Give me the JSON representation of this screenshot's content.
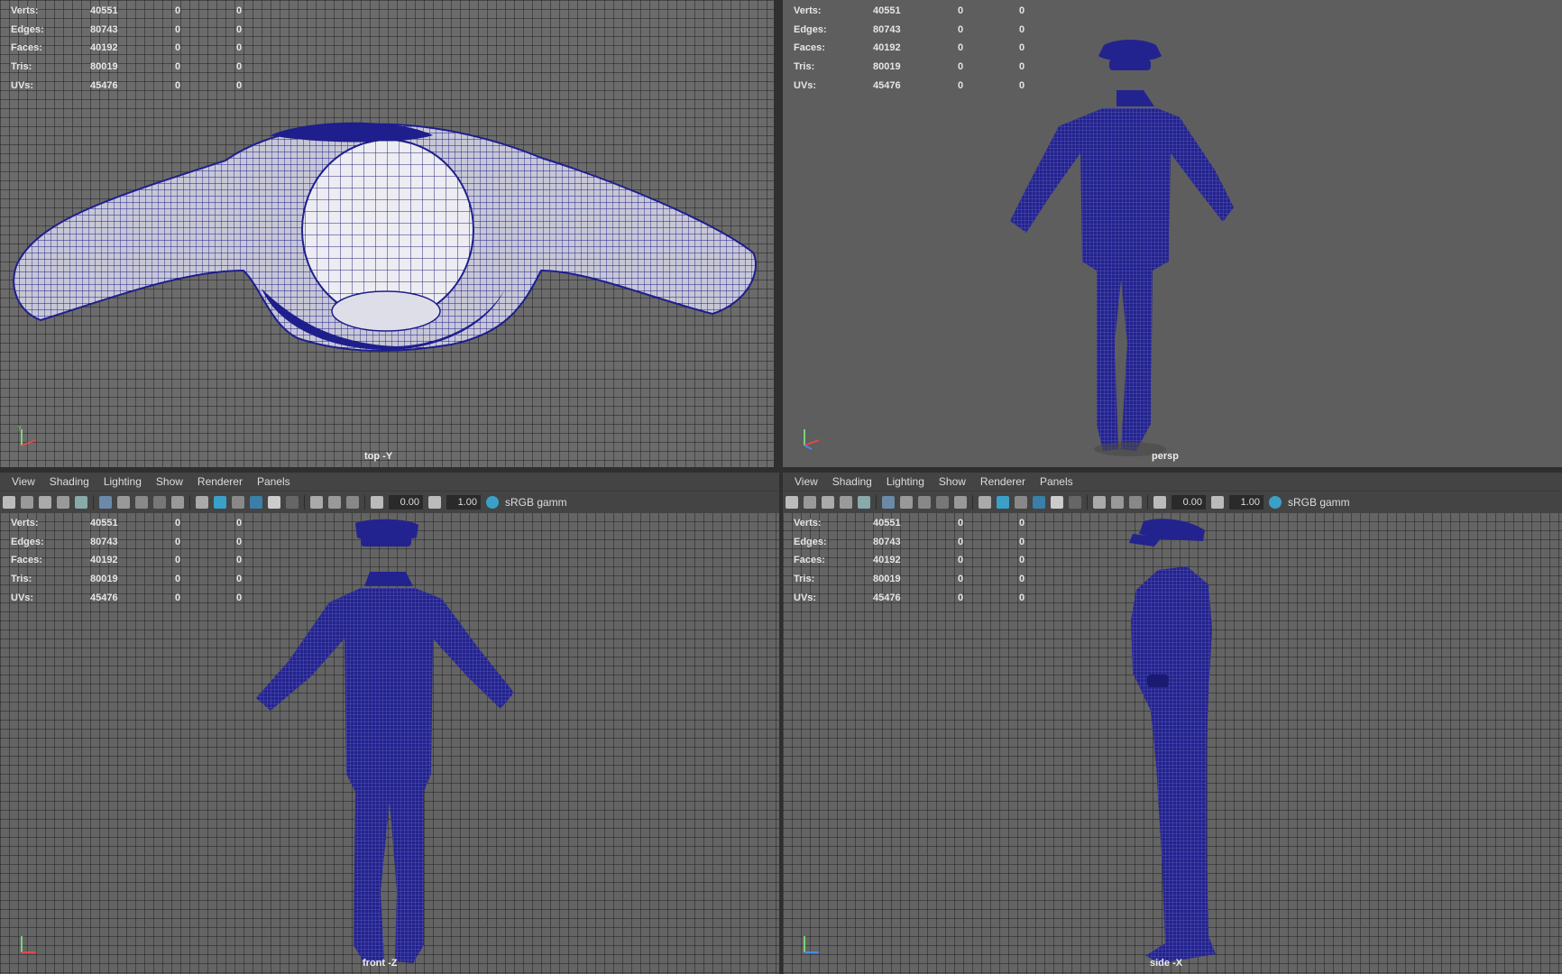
{
  "menus": [
    "View",
    "Shading",
    "Lighting",
    "Show",
    "Renderer",
    "Panels"
  ],
  "toolbar": {
    "field_a": "0.00",
    "field_b": "1.00",
    "color_space": "sRGB gamm"
  },
  "hud_rows": [
    {
      "label": "Verts:",
      "v1": "40551",
      "v2": "0",
      "v3": "0"
    },
    {
      "label": "Edges:",
      "v1": "80743",
      "v2": "0",
      "v3": "0"
    },
    {
      "label": "Faces:",
      "v1": "40192",
      "v2": "0",
      "v3": "0"
    },
    {
      "label": "Tris:",
      "v1": "80019",
      "v2": "0",
      "v3": "0"
    },
    {
      "label": "UVs:",
      "v1": "45476",
      "v2": "0",
      "v3": "0"
    }
  ],
  "viewports": {
    "top": {
      "label": "top -Y"
    },
    "persp": {
      "label": "persp"
    },
    "front": {
      "label": "front -Z"
    },
    "side": {
      "label": "side -X"
    }
  },
  "colors": {
    "mesh": "#1e1e8c",
    "wire_light": "#e8e8f0",
    "accent": "#3aa0c8"
  }
}
